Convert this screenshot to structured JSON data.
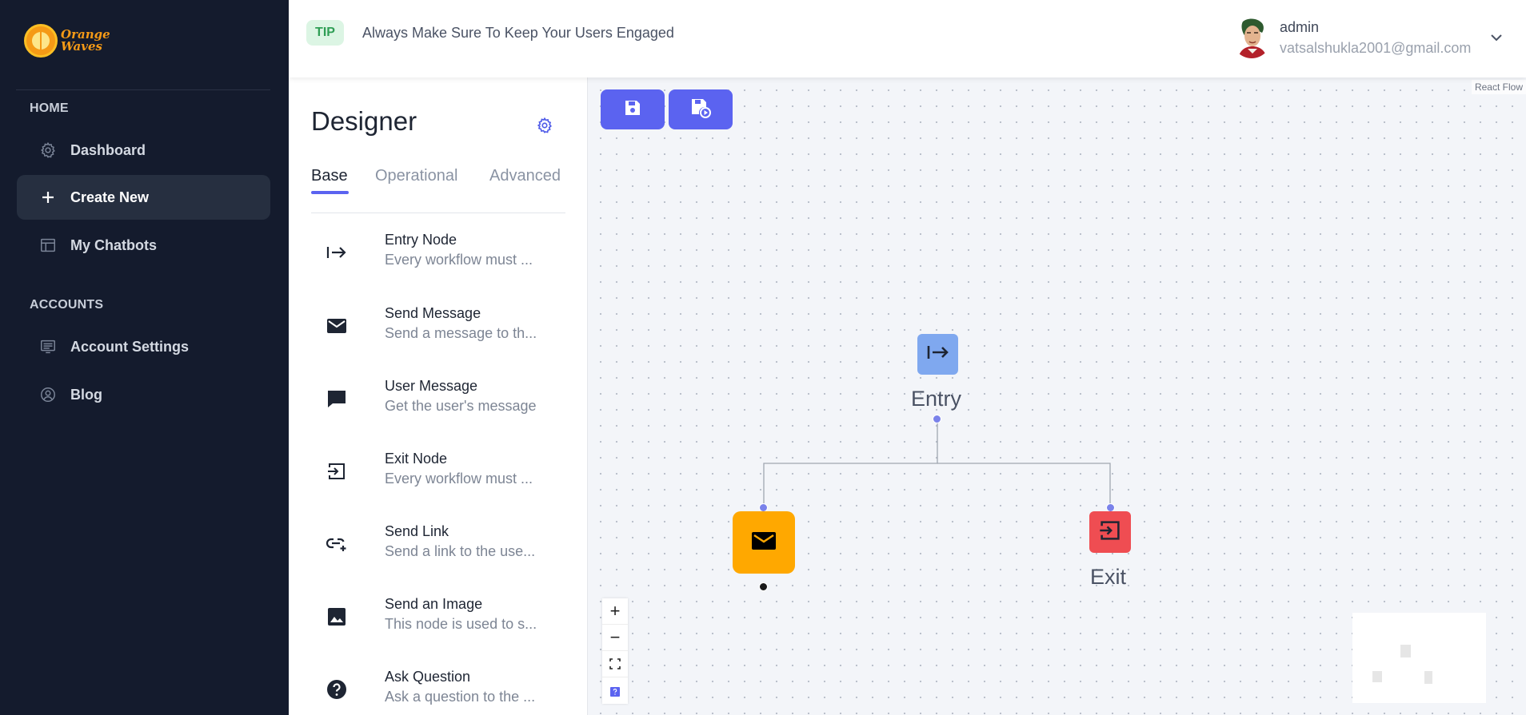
{
  "brand": {
    "logo_line1": "Orange",
    "logo_line2": "Waves"
  },
  "sidebar": {
    "sections": [
      {
        "title": "HOME",
        "items": [
          {
            "label": "Dashboard",
            "icon": "gear-icon",
            "active": false
          },
          {
            "label": "Create New",
            "icon": "plus-icon",
            "active": true
          },
          {
            "label": "My Chatbots",
            "icon": "table-icon",
            "active": false
          }
        ]
      },
      {
        "title": "ACCOUNTS",
        "items": [
          {
            "label": "Account Settings",
            "icon": "monitor-icon",
            "active": false
          },
          {
            "label": "Blog",
            "icon": "user-circle-icon",
            "active": false
          }
        ]
      }
    ]
  },
  "header": {
    "tip_badge": "TIP",
    "tip_text": "Always Make Sure To Keep Your Users Engaged",
    "user_name": "admin",
    "user_email": "vatsalshukla2001@gmail.com"
  },
  "designer": {
    "title": "Designer",
    "tabs": [
      {
        "label": "Base",
        "active": true
      },
      {
        "label": "Operational",
        "active": false
      },
      {
        "label": "Advanced",
        "active": false
      }
    ],
    "nodes": [
      {
        "title": "Entry Node",
        "desc": "Every workflow must ...",
        "icon": "entry-arrow-icon"
      },
      {
        "title": "Send Message",
        "desc": "Send a message to th...",
        "icon": "mail-icon"
      },
      {
        "title": "User Message",
        "desc": "Get the user's message",
        "icon": "chat-bubble-icon"
      },
      {
        "title": "Exit Node",
        "desc": "Every workflow must ...",
        "icon": "exit-icon"
      },
      {
        "title": "Send Link",
        "desc": "Send a link to the use...",
        "icon": "link-icon"
      },
      {
        "title": "Send an Image",
        "desc": "This node is used to s...",
        "icon": "image-icon"
      },
      {
        "title": "Ask Question",
        "desc": "Ask a question to the ...",
        "icon": "question-icon"
      }
    ]
  },
  "canvas": {
    "attribution": "React Flow",
    "toolbar": [
      {
        "icon": "save-icon"
      },
      {
        "icon": "save-run-icon"
      }
    ],
    "flow_nodes": [
      {
        "label": "Entry",
        "color": "#7fa8ef",
        "icon": "entry-arrow-icon"
      },
      {
        "label": "",
        "color": "#ffa800",
        "icon": "mail-icon"
      },
      {
        "label": "Exit",
        "color": "#ef4d52",
        "icon": "exit-icon"
      }
    ],
    "controls": {
      "zoom_in": "+",
      "zoom_out": "−"
    }
  },
  "colors": {
    "sidebar_bg": "#141b2d",
    "accent": "#5b63f0",
    "tip_green": "#2f9e55"
  }
}
